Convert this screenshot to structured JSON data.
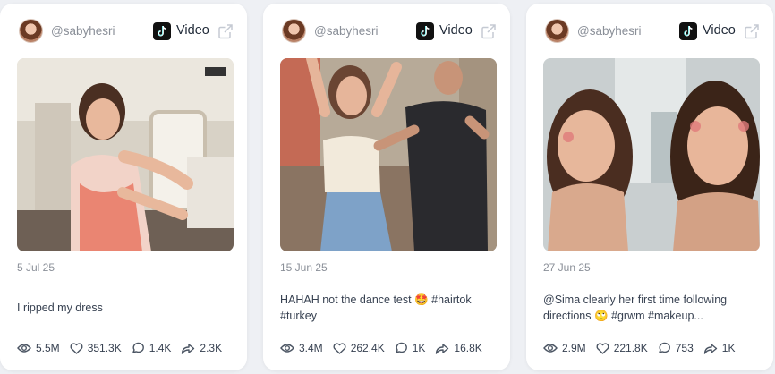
{
  "colors": {
    "background": "#eef0f4",
    "card": "#ffffff",
    "muted": "#8a8f98",
    "text": "#374151"
  },
  "cards": [
    {
      "handle": "@sabyhesri",
      "platform_icon": "tiktok-icon",
      "type": "Video",
      "date": "5 Jul 25",
      "caption": "I ripped my dress",
      "stats": {
        "views": "5.5M",
        "likes": "351.3K",
        "comments": "1.4K",
        "shares": "2.3K"
      }
    },
    {
      "handle": "@sabyhesri",
      "platform_icon": "tiktok-icon",
      "type": "Video",
      "date": "15 Jun 25",
      "caption": "HAHAH not the dance test 🤩 #hairtok #turkey",
      "stats": {
        "views": "3.4M",
        "likes": "262.4K",
        "comments": "1K",
        "shares": "16.8K"
      }
    },
    {
      "handle": "@sabyhesri",
      "platform_icon": "tiktok-icon",
      "type": "Video",
      "date": "27 Jun 25",
      "caption": "@Sima clearly her first time following directions 🙄 #grwm #makeup...",
      "stats": {
        "views": "2.9M",
        "likes": "221.8K",
        "comments": "753",
        "shares": "1K"
      }
    }
  ]
}
